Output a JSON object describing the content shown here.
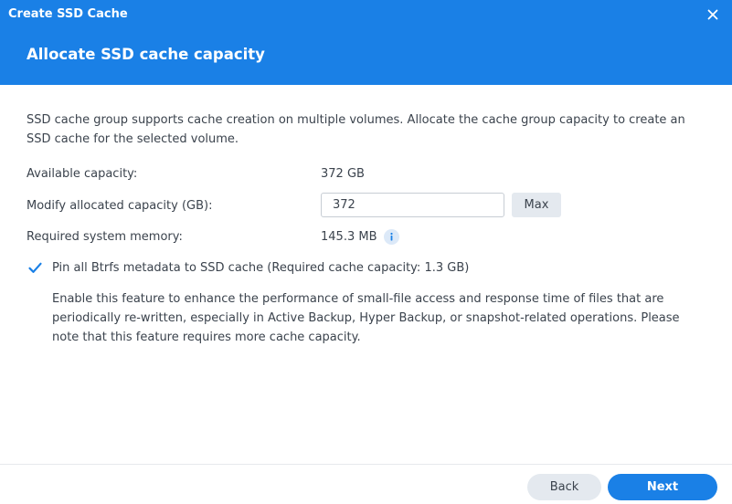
{
  "window": {
    "title": "Create SSD Cache",
    "step_title": "Allocate SSD cache capacity",
    "accent_color": "#1a80e6"
  },
  "content": {
    "description": "SSD cache group supports cache creation on multiple volumes. Allocate the cache group capacity to create an SSD cache for the selected volume.",
    "available_capacity": {
      "label": "Available capacity:",
      "value": "372 GB"
    },
    "allocated_capacity": {
      "label": "Modify allocated capacity (GB):",
      "input_value": "372",
      "max_button_label": "Max"
    },
    "required_memory": {
      "label": "Required system memory:",
      "value": "145.3 MB",
      "icon": "info-icon"
    },
    "pin_metadata": {
      "checked": true,
      "label": "Pin all Btrfs metadata to SSD cache (Required cache capacity: 1.3 GB)",
      "description": "Enable this feature to enhance the performance of small-file access and response time of files that are periodically re-written, especially in Active Backup, Hyper Backup, or snapshot-related operations. Please note that this feature requires more cache capacity."
    }
  },
  "footer": {
    "back_label": "Back",
    "next_label": "Next"
  }
}
